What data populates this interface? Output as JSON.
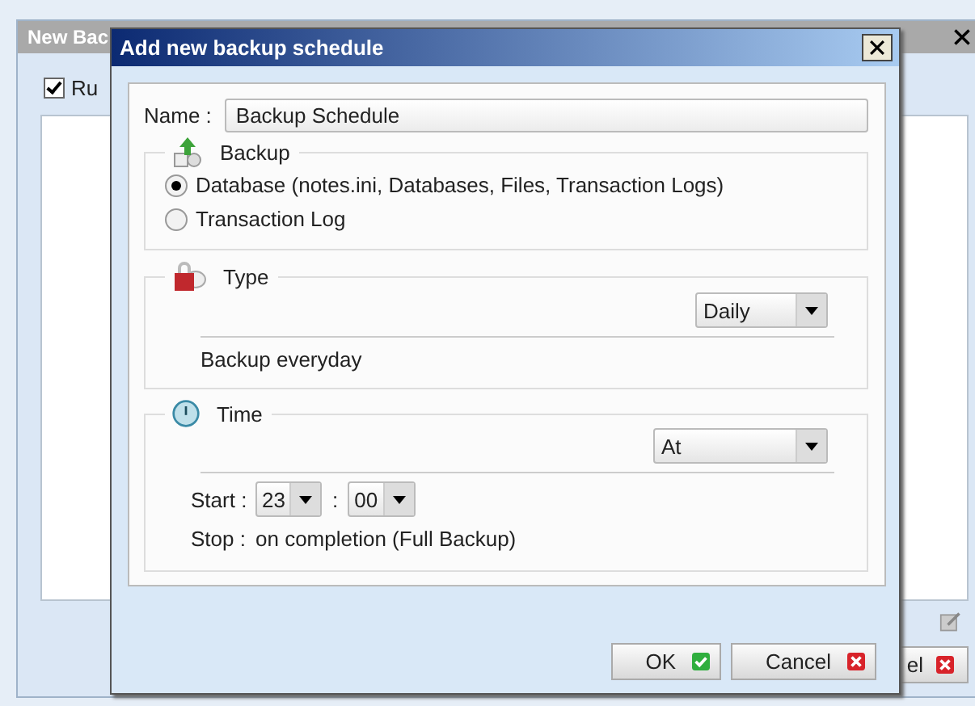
{
  "background_window": {
    "title": "New Bac",
    "checkbox": {
      "label": "Ru",
      "checked": true
    },
    "cancel_button": "el"
  },
  "dialog": {
    "title": "Add new backup schedule",
    "name": {
      "label": "Name :",
      "value": "Backup Schedule"
    },
    "backup": {
      "legend": "Backup",
      "options": [
        {
          "label": "Database (notes.ini, Databases, Files, Transaction Logs)",
          "selected": true
        },
        {
          "label": "Transaction Log",
          "selected": false
        }
      ]
    },
    "type": {
      "legend": "Type",
      "select": "Daily",
      "description": "Backup everyday"
    },
    "time": {
      "legend": "Time",
      "select": "At",
      "start_label": "Start :",
      "hour": "23",
      "separator": ":",
      "minute": "00",
      "stop_label": "Stop :",
      "stop_value": "on completion (Full Backup)"
    },
    "buttons": [
      {
        "label": "OK",
        "kind": "ok"
      },
      {
        "label": "Cancel",
        "kind": "cancel"
      }
    ]
  }
}
